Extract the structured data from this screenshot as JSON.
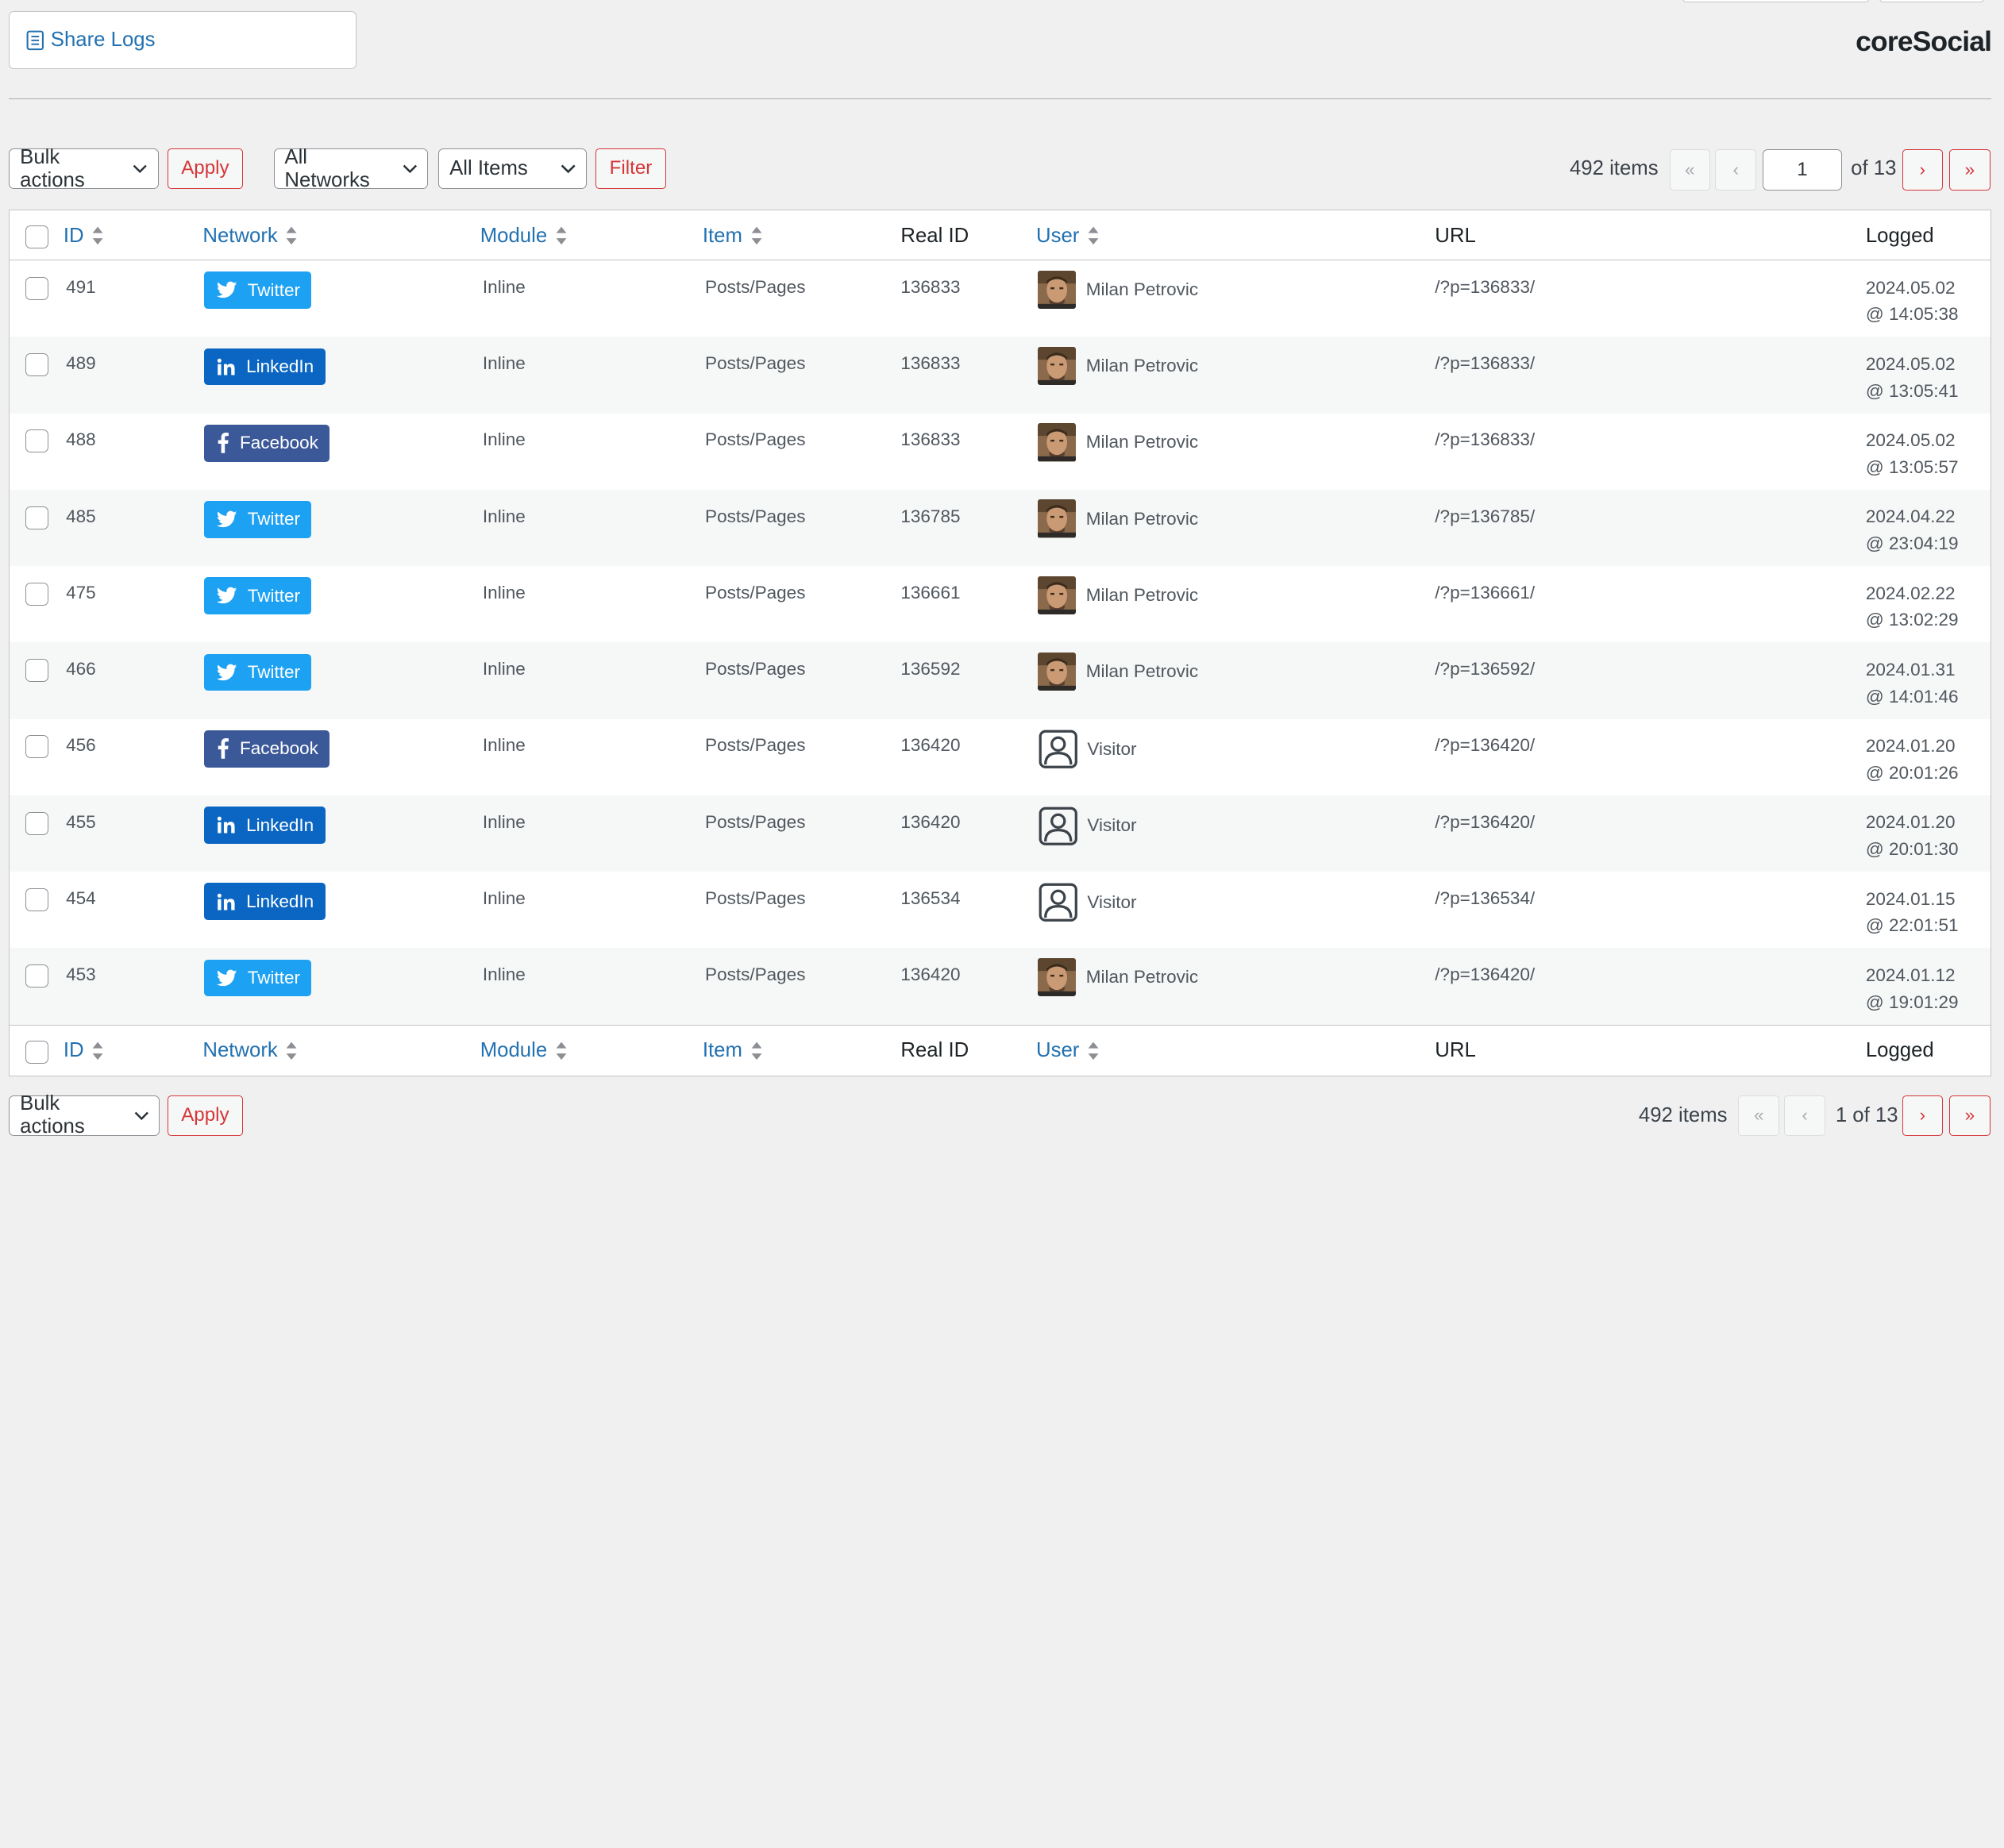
{
  "header": {
    "tab_label": "Share Logs",
    "brand": "coreSocial"
  },
  "toolbar_top": {
    "bulk_actions": "Bulk actions",
    "apply": "Apply",
    "networks": "All Networks",
    "items_filter": "All Items",
    "filter": "Filter",
    "items_count": "492 items",
    "first": "«",
    "prev": "‹",
    "current_page": "1",
    "of_pages": "of 13",
    "next": "›",
    "last": "»"
  },
  "columns": {
    "id": "ID",
    "network": "Network",
    "module": "Module",
    "item": "Item",
    "real_id": "Real ID",
    "user": "User",
    "url": "URL",
    "logged": "Logged"
  },
  "rows": [
    {
      "id": "491",
      "network": "Twitter",
      "network_type": "twitter",
      "module": "Inline",
      "item": "Posts/Pages",
      "real_id": "136833",
      "user": "Milan Petrovic",
      "user_type": "member",
      "url": "/?p=136833/",
      "date": "2024.05.02",
      "time": "@ 14:05:38"
    },
    {
      "id": "489",
      "network": "LinkedIn",
      "network_type": "linkedin",
      "module": "Inline",
      "item": "Posts/Pages",
      "real_id": "136833",
      "user": "Milan Petrovic",
      "user_type": "member",
      "url": "/?p=136833/",
      "date": "2024.05.02",
      "time": "@ 13:05:41"
    },
    {
      "id": "488",
      "network": "Facebook",
      "network_type": "facebook",
      "module": "Inline",
      "item": "Posts/Pages",
      "real_id": "136833",
      "user": "Milan Petrovic",
      "user_type": "member",
      "url": "/?p=136833/",
      "date": "2024.05.02",
      "time": "@ 13:05:57"
    },
    {
      "id": "485",
      "network": "Twitter",
      "network_type": "twitter",
      "module": "Inline",
      "item": "Posts/Pages",
      "real_id": "136785",
      "user": "Milan Petrovic",
      "user_type": "member",
      "url": "/?p=136785/",
      "date": "2024.04.22",
      "time": "@ 23:04:19"
    },
    {
      "id": "475",
      "network": "Twitter",
      "network_type": "twitter",
      "module": "Inline",
      "item": "Posts/Pages",
      "real_id": "136661",
      "user": "Milan Petrovic",
      "user_type": "member",
      "url": "/?p=136661/",
      "date": "2024.02.22",
      "time": "@ 13:02:29"
    },
    {
      "id": "466",
      "network": "Twitter",
      "network_type": "twitter",
      "module": "Inline",
      "item": "Posts/Pages",
      "real_id": "136592",
      "user": "Milan Petrovic",
      "user_type": "member",
      "url": "/?p=136592/",
      "date": "2024.01.31",
      "time": "@ 14:01:46"
    },
    {
      "id": "456",
      "network": "Facebook",
      "network_type": "facebook",
      "module": "Inline",
      "item": "Posts/Pages",
      "real_id": "136420",
      "user": "Visitor",
      "user_type": "visitor",
      "url": "/?p=136420/",
      "date": "2024.01.20",
      "time": "@ 20:01:26"
    },
    {
      "id": "455",
      "network": "LinkedIn",
      "network_type": "linkedin",
      "module": "Inline",
      "item": "Posts/Pages",
      "real_id": "136420",
      "user": "Visitor",
      "user_type": "visitor",
      "url": "/?p=136420/",
      "date": "2024.01.20",
      "time": "@ 20:01:30"
    },
    {
      "id": "454",
      "network": "LinkedIn",
      "network_type": "linkedin",
      "module": "Inline",
      "item": "Posts/Pages",
      "real_id": "136534",
      "user": "Visitor",
      "user_type": "visitor",
      "url": "/?p=136534/",
      "date": "2024.01.15",
      "time": "@ 22:01:51"
    },
    {
      "id": "453",
      "network": "Twitter",
      "network_type": "twitter",
      "module": "Inline",
      "item": "Posts/Pages",
      "real_id": "136420",
      "user": "Milan Petrovic",
      "user_type": "member",
      "url": "/?p=136420/",
      "date": "2024.01.12",
      "time": "@ 19:01:29"
    }
  ],
  "toolbar_bottom": {
    "bulk_actions": "Bulk actions",
    "apply": "Apply",
    "items_count": "492 items",
    "first": "«",
    "prev": "‹",
    "page_text": "1 of 13",
    "next": "›",
    "last": "»"
  },
  "colors": {
    "link": "#2271b1",
    "accent_red": "#d63638",
    "twitter": "#1da1f2",
    "linkedin": "#0a66c2",
    "facebook": "#3b5998"
  }
}
